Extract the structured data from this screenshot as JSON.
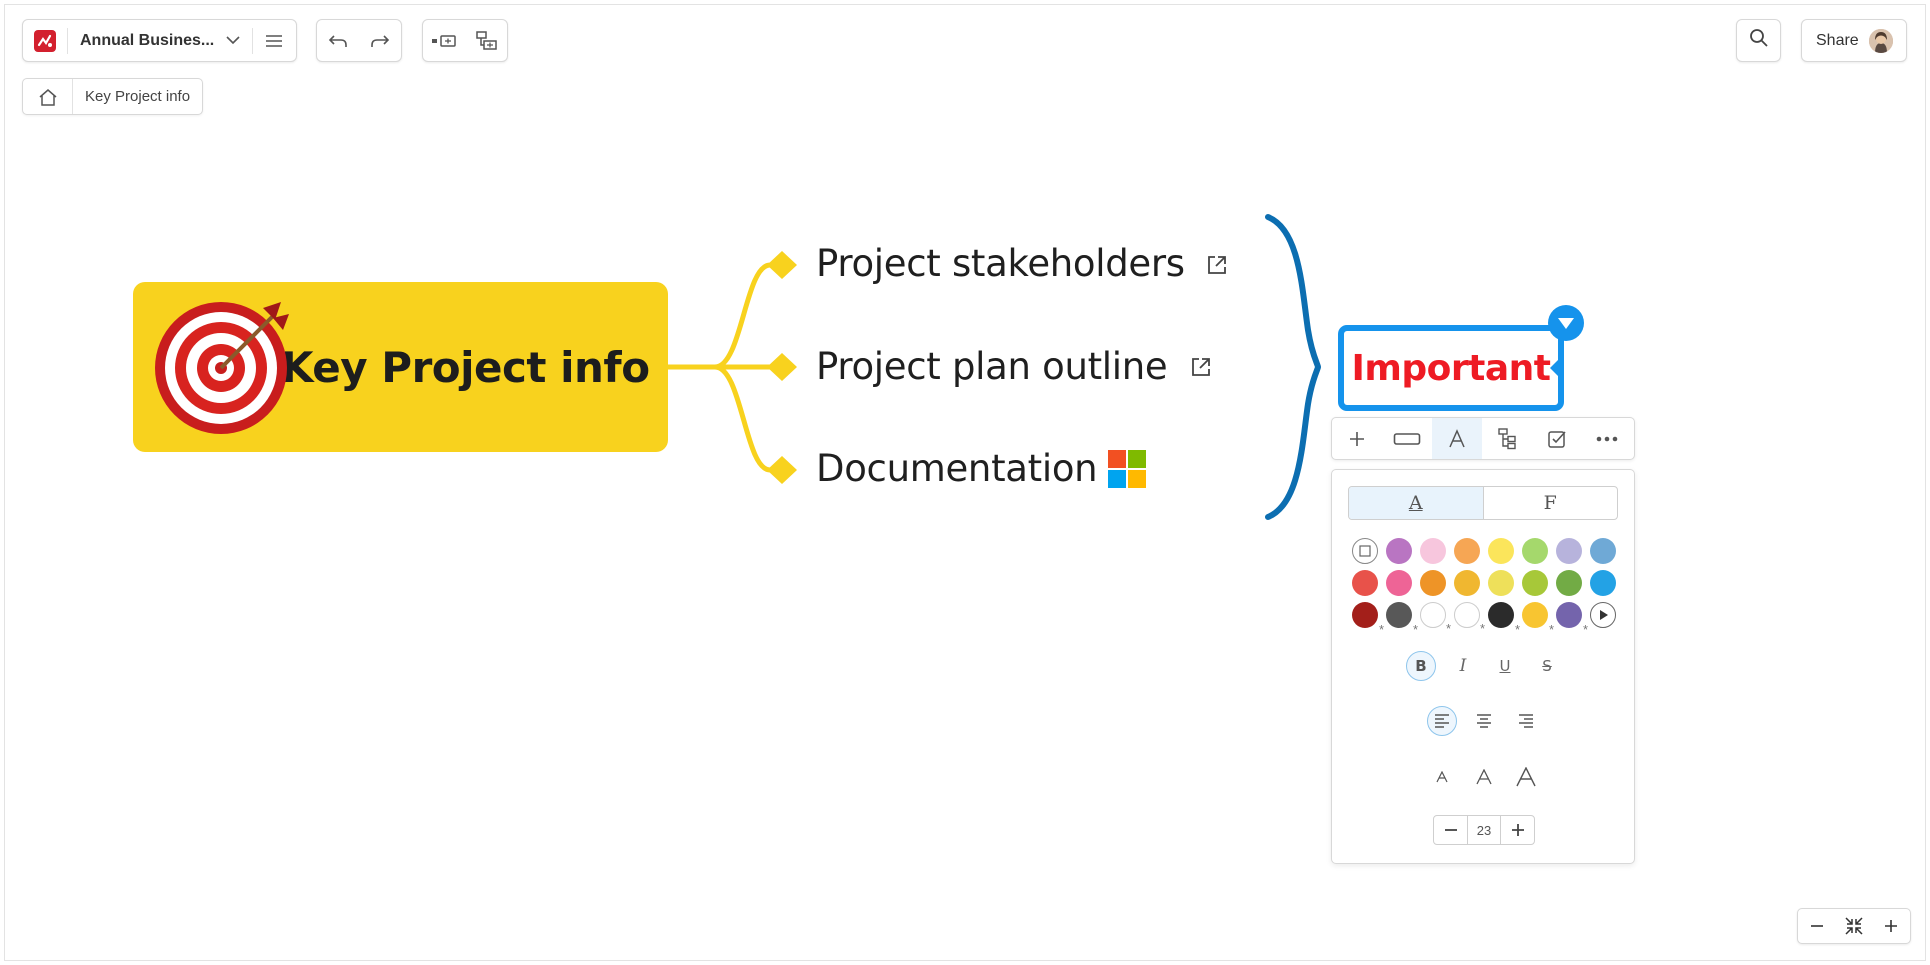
{
  "toolbar": {
    "doc_title": "Annual Busines...",
    "share_label": "Share"
  },
  "breadcrumb": {
    "current": "Key Project info"
  },
  "map": {
    "central_topic": "Key Project info",
    "topics": [
      {
        "label": "Project stakeholders",
        "attachment": "external-link-icon"
      },
      {
        "label": "Project plan outline",
        "attachment": "external-link-icon"
      },
      {
        "label": "Documentation",
        "attachment": "microsoft-logo"
      }
    ],
    "callout": "Important",
    "colors": {
      "central_fill": "#f8d21e",
      "branch": "#f8d21e",
      "brace": "#0c6eb1",
      "callout_border": "#1593ec",
      "callout_text": "#ee1b24"
    }
  },
  "format_panel": {
    "tabs": [
      "A",
      "F"
    ],
    "active_tab": "A",
    "swatches": [
      [
        "none",
        "#b975c2",
        "#f7c6dd",
        "#f6a654",
        "#fbe55b",
        "#a5d86c",
        "#b7b3dc",
        "#6fa9d6"
      ],
      [
        "#e8524a",
        "#ee6496",
        "#ee9427",
        "#f0b730",
        "#eee05a",
        "#a7c839",
        "#72ab45",
        "#23a2e5"
      ],
      [
        "#a31f1a",
        "#585858",
        "#ffffff",
        "#ffffff",
        "#2b2b2b",
        "#f8c531",
        "#7464ac",
        "more"
      ]
    ],
    "styles": [
      "B",
      "I",
      "U",
      "S"
    ],
    "font_size": "23"
  }
}
